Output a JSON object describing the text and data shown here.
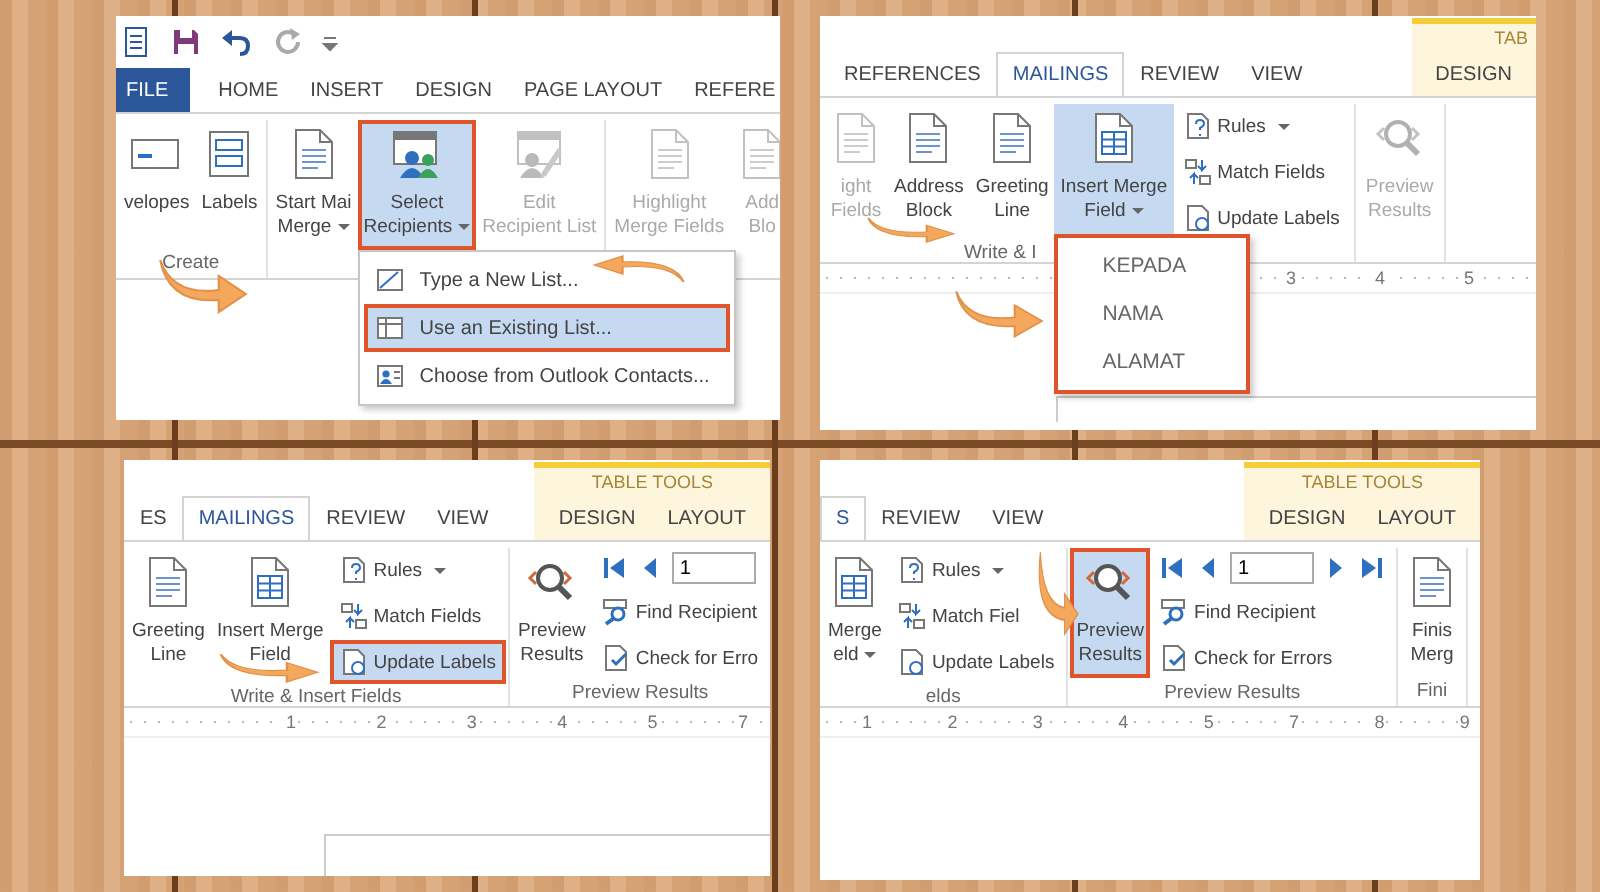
{
  "rows": [
    {
      "panels": [
        {
          "quick_access": true,
          "tabs": [
            {
              "label": "FILE",
              "kind": "file",
              "selected": false
            },
            {
              "label": "HOME",
              "kind": "plain",
              "selected": false
            },
            {
              "label": "INSERT",
              "kind": "plain",
              "selected": false
            },
            {
              "label": "DESIGN",
              "kind": "plain",
              "selected": false
            },
            {
              "label": "PAGE LAYOUT",
              "kind": "plain",
              "selected": false
            },
            {
              "label": "REFERE",
              "kind": "plain",
              "selected": false
            }
          ],
          "groups": [
            {
              "label": "Create",
              "items": [
                {
                  "kind": "large",
                  "lines": [
                    "velopes"
                  ]
                },
                {
                  "kind": "large",
                  "lines": [
                    "Labels"
                  ]
                }
              ]
            },
            {
              "items": [
                {
                  "kind": "large",
                  "lines": [
                    "Start Mai",
                    "Merge"
                  ],
                  "menu": true
                },
                {
                  "kind": "large",
                  "lines": [
                    "Select",
                    "Recipients"
                  ],
                  "menu": true,
                  "selected": true,
                  "highlighted": true,
                  "dropdown": {
                    "highlighted": false,
                    "items": [
                      {
                        "label": "Type a New List...",
                        "selected": false,
                        "highlighted": false
                      },
                      {
                        "label": "Use an Existing List...",
                        "selected": true,
                        "highlighted": true
                      },
                      {
                        "label": "Choose from Outlook Contacts...",
                        "selected": false,
                        "highlighted": false
                      }
                    ]
                  }
                },
                {
                  "kind": "large",
                  "lines": [
                    "Edit",
                    "Recipient List"
                  ],
                  "disabled": true
                }
              ]
            },
            {
              "items": [
                {
                  "kind": "large",
                  "lines": [
                    "Highlight",
                    "Merge Fields"
                  ],
                  "disabled": true
                },
                {
                  "kind": "large",
                  "lines": [
                    "Add",
                    "Blo"
                  ],
                  "disabled": true
                }
              ]
            }
          ]
        },
        {
          "context_header": "TAB",
          "tabs": [
            {
              "label": "REFERENCES",
              "kind": "plain",
              "selected": false
            },
            {
              "label": "MAILINGS",
              "kind": "plain",
              "selected": true
            },
            {
              "label": "REVIEW",
              "kind": "plain",
              "selected": false
            },
            {
              "label": "VIEW",
              "kind": "plain",
              "selected": false
            },
            {
              "label": "DESIGN",
              "kind": "contextual",
              "selected": false
            }
          ],
          "groups": [
            {
              "label": "Write & I",
              "items": [
                {
                  "kind": "large",
                  "lines": [
                    "ight",
                    "Fields"
                  ],
                  "disabled": true
                },
                {
                  "kind": "large",
                  "lines": [
                    "Address",
                    "Block"
                  ]
                },
                {
                  "kind": "large",
                  "lines": [
                    "Greeting",
                    "Line"
                  ]
                },
                {
                  "kind": "large",
                  "lines": [
                    "Insert Merge",
                    "Field"
                  ],
                  "menu": true,
                  "selected": true,
                  "highlighted": false,
                  "dropdown": {
                    "highlighted": true,
                    "items": [
                      {
                        "label": "KEPADA",
                        "selected": false,
                        "highlighted": false
                      },
                      {
                        "label": "NAMA",
                        "selected": false,
                        "highlighted": false
                      },
                      {
                        "label": "ALAMAT",
                        "selected": false,
                        "highlighted": false
                      }
                    ]
                  }
                },
                {
                  "kind": "stack",
                  "items": [
                    {
                      "kind": "small",
                      "label": "Rules",
                      "menu": true
                    },
                    {
                      "kind": "small",
                      "label": "Match Fields"
                    },
                    {
                      "kind": "small",
                      "label": "Update Labels"
                    }
                  ]
                }
              ]
            },
            {
              "items": [
                {
                  "kind": "large",
                  "lines": [
                    "Preview",
                    "Results"
                  ],
                  "disabled": true
                }
              ]
            }
          ],
          "ruler": [
            "3",
            "4",
            "5"
          ],
          "page_edge": true
        }
      ]
    },
    {
      "panels": [
        {
          "context_header": "TABLE TOOLS",
          "tabs": [
            {
              "label": "ES",
              "kind": "plain",
              "selected": false
            },
            {
              "label": "MAILINGS",
              "kind": "plain",
              "selected": true
            },
            {
              "label": "REVIEW",
              "kind": "plain",
              "selected": false
            },
            {
              "label": "VIEW",
              "kind": "plain",
              "selected": false
            },
            {
              "label": "DESIGN",
              "kind": "contextual",
              "selected": false
            },
            {
              "label": "LAYOUT",
              "kind": "contextual",
              "selected": false
            }
          ],
          "groups": [
            {
              "label": "Write & Insert Fields",
              "items": [
                {
                  "kind": "large",
                  "lines": [
                    "Greeting",
                    "Line"
                  ]
                },
                {
                  "kind": "large",
                  "lines": [
                    "Insert Merge",
                    "Field"
                  ]
                },
                {
                  "kind": "stack",
                  "items": [
                    {
                      "kind": "small",
                      "label": "Rules",
                      "menu": true
                    },
                    {
                      "kind": "small",
                      "label": "Match Fields"
                    },
                    {
                      "kind": "small",
                      "label": "Update Labels",
                      "selected": true,
                      "highlighted": true
                    }
                  ]
                }
              ]
            },
            {
              "label": "Preview Results",
              "items": [
                {
                  "kind": "large",
                  "lines": [
                    "Preview",
                    "Results"
                  ]
                },
                {
                  "kind": "stack",
                  "items": [
                    {
                      "kind": "nav",
                      "value": "1"
                    },
                    {
                      "kind": "small",
                      "label": "Find Recipient"
                    },
                    {
                      "kind": "small",
                      "label": "Check for Erro"
                    }
                  ]
                }
              ]
            }
          ],
          "ruler": [
            "1",
            "2",
            "3",
            "4",
            "5",
            "7"
          ],
          "page_edge": true
        },
        {
          "context_header": "TABLE TOOLS",
          "tabs": [
            {
              "label": "S",
              "kind": "plain",
              "selected": true
            },
            {
              "label": "REVIEW",
              "kind": "plain",
              "selected": false
            },
            {
              "label": "VIEW",
              "kind": "plain",
              "selected": false
            },
            {
              "label": "DESIGN",
              "kind": "contextual",
              "selected": false
            },
            {
              "label": "LAYOUT",
              "kind": "contextual",
              "selected": false
            }
          ],
          "groups": [
            {
              "label": "elds",
              "items": [
                {
                  "kind": "large",
                  "lines": [
                    "Merge",
                    "eld"
                  ],
                  "menu": true
                },
                {
                  "kind": "stack",
                  "items": [
                    {
                      "kind": "small",
                      "label": "Rules",
                      "menu": true
                    },
                    {
                      "kind": "small",
                      "label": "Match Fiel"
                    },
                    {
                      "kind": "small",
                      "label": "Update Labels"
                    }
                  ]
                }
              ]
            },
            {
              "label": "Preview Results",
              "items": [
                {
                  "kind": "large",
                  "lines": [
                    "Preview",
                    "Results"
                  ],
                  "selected": true,
                  "highlighted": true
                },
                {
                  "kind": "stack",
                  "items": [
                    {
                      "kind": "nav",
                      "value": "1"
                    },
                    {
                      "kind": "small",
                      "label": "Find Recipient"
                    },
                    {
                      "kind": "small",
                      "label": "Check for Errors"
                    }
                  ]
                }
              ]
            },
            {
              "label": "Fini",
              "items": [
                {
                  "kind": "large",
                  "lines": [
                    "Finis",
                    "Merg"
                  ]
                }
              ]
            }
          ],
          "ruler": [
            "1",
            "2",
            "3",
            "4",
            "5",
            "7",
            "8",
            "9"
          ]
        }
      ]
    }
  ]
}
